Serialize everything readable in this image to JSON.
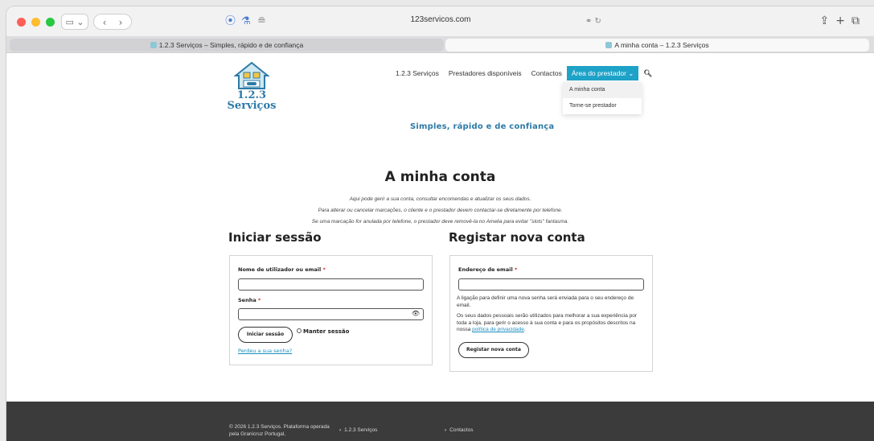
{
  "browser": {
    "url": "123servicos.com",
    "tabs": [
      {
        "label": "1.2.3 Serviços – Simples, rápido e de confiança"
      },
      {
        "label": "A minha conta – 1.2.3 Serviços"
      }
    ]
  },
  "site": {
    "logo_line1": "1.2.3",
    "logo_line2": "Serviços",
    "tagline": "Simples, rápido e de confiança",
    "menu": [
      {
        "label": "1.2.3 Serviços"
      },
      {
        "label": "Prestadores disponíveis"
      },
      {
        "label": "Contactos"
      },
      {
        "label": "Área do prestador ⌄"
      }
    ],
    "dropdown": [
      {
        "label": "A minha conta"
      },
      {
        "label": "Torne-se prestador"
      }
    ]
  },
  "page": {
    "title": "A minha conta",
    "intro": [
      "Aqui pode gerir a sua conta, consultar encomendas e atualizar os seus dados.",
      "Para alterar ou cancelar marcações, o cliente e o prestador devem contactar-se diretamente por telefone.",
      "Se uma marcação for anulada por telefone, o prestador deve removê-la no Amelia para evitar \"slots\" fantasma."
    ]
  },
  "login": {
    "title": "Iniciar sessão",
    "username_label": "Nome de utilizador ou email",
    "password_label": "Senha",
    "required_mark": "*",
    "submit_label": "Iniciar sessão",
    "remember_label": "Manter sessão",
    "lost_password": "Perdeu a sua senha?"
  },
  "register": {
    "title": "Registar nova conta",
    "email_label": "Endereço de email",
    "info": "A ligação para definir uma nova senha será enviada para o seu endereço de email.",
    "privacy_text": "Os seus dados pessoais serão utilizados para melhorar a sua experiência por toda a loja, para gerir o acesso à sua conta e para os propósitos descritos na nossa",
    "privacy_link": "política de privacidade",
    "submit_label": "Registar nova conta"
  },
  "footer": {
    "copyright": "© 2026 1.2.3 Serviços. Plataforma operada pela Granicruz Portugal,",
    "link1": "1.2.3 Serviços",
    "link2": "Contactos"
  },
  "colors": {
    "accent": "#1ea2c7",
    "brand": "#2d7aa7",
    "footer_bg": "#3b3b3b"
  }
}
